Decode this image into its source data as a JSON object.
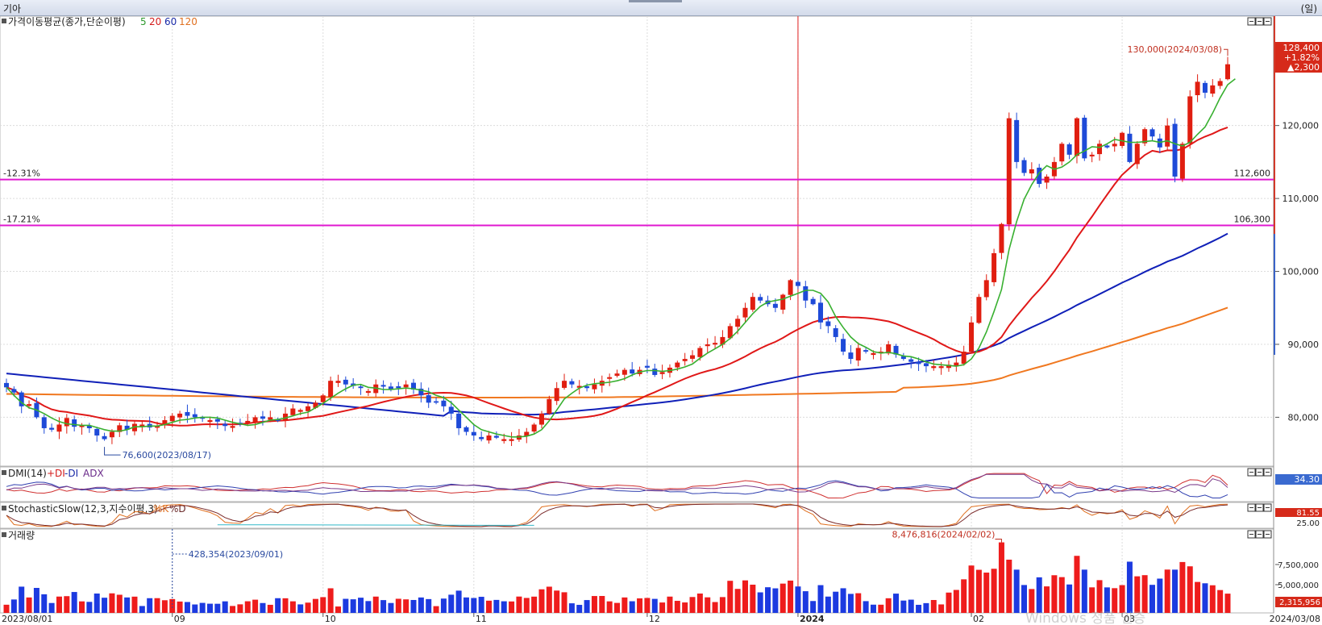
{
  "window": {
    "title": "기아",
    "period_unit": "(일)",
    "watermark": "Windows 정품 인증"
  },
  "legends": {
    "price": {
      "label": "가격이동평균(종가,단순이평)",
      "periods": [
        "5",
        "20",
        "60",
        "120"
      ]
    },
    "dmi": {
      "label": "DMI(14)",
      "items": [
        "+DI",
        "-DI",
        "ADX"
      ]
    },
    "stochastic": {
      "label": "StochasticSlow(12,3,지수이평,3)",
      "items": [
        "%K",
        "%D"
      ]
    },
    "volume": {
      "label": "거래량"
    }
  },
  "price_panel": {
    "current_price": "128,400",
    "change_pct": "+1.82%",
    "change_amt": "▲2,300",
    "high_annotation": "130,000(2024/03/08)",
    "low_annotation": "76,600(2023/08/17)",
    "hline1": {
      "value": 112600,
      "label": "112,600",
      "pct": "-12.31%"
    },
    "hline2": {
      "value": 106300,
      "label": "106,300",
      "pct": "-17.21%"
    }
  },
  "dmi_panel": {
    "value_label": "34.30"
  },
  "stoch_panel": {
    "value_label": "81.55",
    "level_label": "25.00"
  },
  "volume_panel": {
    "max_annotation": "8,476,816(2024/02/02)",
    "ref_annotation": "428,354(2023/09/01)",
    "current_label": "2,315,956",
    "tick_labels": [
      "7,500,000",
      "5,000,000"
    ]
  },
  "chart_data": {
    "type": "candlestick",
    "x_axis": {
      "start_label": "2023/08/01",
      "end_label": "2024/03/08",
      "month_ticks": [
        {
          "label": "09",
          "index": 22
        },
        {
          "label": "10",
          "index": 42
        },
        {
          "label": "11",
          "index": 62
        },
        {
          "label": "12",
          "index": 85
        },
        {
          "label": "2024",
          "index": 105
        },
        {
          "label": "02",
          "index": 128
        },
        {
          "label": "03",
          "index": 148
        }
      ],
      "marker_index": 105
    },
    "y_axis": {
      "ticks": [
        80000,
        90000,
        100000,
        110000,
        120000
      ],
      "tick_labels": [
        "80,000",
        "90,000",
        "100,000",
        "110,000",
        "120,000"
      ],
      "range": [
        73300,
        135000
      ]
    },
    "close": [
      84100,
      83400,
      81500,
      81800,
      80000,
      78500,
      78300,
      79000,
      79900,
      78700,
      78900,
      78500,
      77500,
      77000,
      78000,
      78900,
      78300,
      79100,
      79000,
      78600,
      78800,
      79600,
      80200,
      80500,
      80200,
      80000,
      79800,
      79600,
      79400,
      78800,
      78800,
      79000,
      79500,
      80000,
      79800,
      80000,
      79500,
      80500,
      81200,
      81000,
      81500,
      82000,
      83000,
      85000,
      85000,
      84500,
      84300,
      84000,
      83600,
      84500,
      84200,
      83800,
      84000,
      84500,
      83800,
      83000,
      82000,
      82000,
      81500,
      80500,
      78500,
      78000,
      77500,
      77000,
      77500,
      77200,
      77000,
      77000,
      77500,
      78000,
      79000,
      80500,
      82500,
      84000,
      85000,
      84500,
      84300,
      84000,
      84500,
      85000,
      85500,
      86000,
      86500,
      86000,
      86500,
      86800,
      85800,
      86200,
      86800,
      87500,
      88000,
      88500,
      89500,
      90000,
      90200,
      91000,
      92500,
      93500,
      95000,
      96500,
      96000,
      95500,
      95000,
      96800,
      98800,
      98000,
      96000,
      95500,
      93000,
      92500,
      91000,
      89000,
      88000,
      89500,
      89000,
      88800,
      89000,
      90000,
      88600,
      88000,
      87600,
      87300,
      87000,
      87000,
      87000,
      87200,
      87500,
      89000,
      93000,
      96500,
      98800,
      102500,
      106500,
      121000,
      115000,
      113500,
      114000,
      112000,
      113000,
      115000,
      117500,
      116000,
      121000,
      115500,
      116000,
      117500,
      117000,
      117500,
      119000,
      115000,
      117500,
      119500,
      118500,
      117000,
      120000,
      113000,
      117500,
      124000,
      126000,
      124500,
      125500,
      126100,
      128400
    ],
    "ma5": [
      84100,
      83000,
      82000,
      81300,
      81000,
      80500,
      79900,
      79400,
      79100,
      79000,
      78900,
      78900,
      78600,
      78300,
      78100,
      78100,
      78300,
      78700,
      78700,
      78800,
      78800,
      79000,
      79300,
      79600,
      79700,
      79900,
      80000,
      80000,
      79900,
      79600,
      79300,
      79100,
      78900,
      79000,
      79300,
      79600,
      79700,
      79900,
      80200,
      80500,
      80700,
      81300,
      81900,
      82600,
      83300,
      83900,
      84400,
      84500,
      84100,
      84000,
      83800,
      83800,
      83900,
      84000,
      83900,
      83700,
      83500,
      83000,
      82700,
      82000,
      81000,
      80000,
      79000,
      78300,
      78000,
      77700,
      77500,
      77300,
      77300,
      77400,
      77700,
      78300,
      79500,
      81000,
      82500,
      83300,
      84000,
      84400,
      84600,
      84700,
      84800,
      85000,
      85300,
      85800,
      86200,
      86400,
      86400,
      86300,
      86400,
      86600,
      86900,
      87300,
      88100,
      88800,
      89400,
      90000,
      90800,
      91800,
      93000,
      94200,
      95200,
      95800,
      96000,
      96200,
      96600,
      97000,
      97400,
      97400,
      97000,
      95800,
      93800,
      92300,
      91000,
      90100,
      89600,
      89000,
      88800,
      88900,
      88700,
      88400,
      88300,
      88000,
      87600,
      87300,
      87200,
      87100,
      87000,
      87200,
      88000,
      89500,
      91700,
      94500,
      97500,
      103000,
      106800,
      109900,
      111900,
      113500,
      114500,
      114000,
      114300,
      115000,
      116000,
      116500,
      117100,
      117000,
      117500,
      118100,
      117900,
      117700,
      117700,
      117800,
      117900,
      117700,
      117900,
      117500,
      117200,
      117700,
      118800,
      119800,
      121700,
      123800,
      125600,
      126400
    ]
  }
}
